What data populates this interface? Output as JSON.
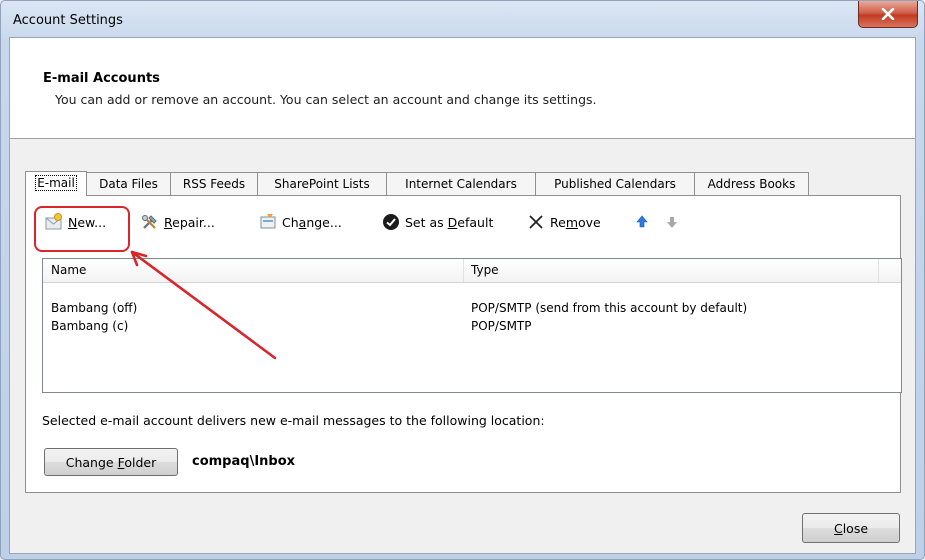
{
  "window": {
    "title": "Account Settings"
  },
  "header": {
    "title": "E-mail Accounts",
    "description": "You can add or remove an account. You can select an account and change its settings."
  },
  "tabs": [
    {
      "label": "E-mail",
      "active": true
    },
    {
      "label": "Data Files"
    },
    {
      "label": "RSS Feeds"
    },
    {
      "label": "SharePoint Lists"
    },
    {
      "label": "Internet Calendars"
    },
    {
      "label": "Published Calendars"
    },
    {
      "label": "Address Books"
    }
  ],
  "toolbar": {
    "new": {
      "pre": "",
      "key": "N",
      "post": "ew...",
      "icon": "new-mail-icon"
    },
    "repair": {
      "pre": "",
      "key": "R",
      "post": "epair...",
      "icon": "repair-tools-icon"
    },
    "change": {
      "pre": "Ch",
      "key": "a",
      "post": "nge...",
      "icon": "change-account-icon"
    },
    "set_default": {
      "pre": "Set as ",
      "key": "D",
      "post": "efault",
      "icon": "checkmark-circle-icon"
    },
    "remove": {
      "pre": "Re",
      "key": "m",
      "post": "ove",
      "icon": "remove-x-icon"
    },
    "move_up": {
      "icon": "arrow-up-icon"
    },
    "move_down": {
      "icon": "arrow-down-icon"
    }
  },
  "list": {
    "columns": [
      "Name",
      "Type"
    ],
    "rows": [
      {
        "name": "Bambang (off)",
        "type": "POP/SMTP (send from this account by default)"
      },
      {
        "name": "Bambang (c)",
        "type": "POP/SMTP"
      }
    ]
  },
  "delivery": {
    "label": "Selected e-mail account delivers new e-mail messages to the following location:",
    "change_folder": {
      "pre": "Change ",
      "key": "F",
      "post": "older"
    },
    "folder_path": "compaq\\Inbox"
  },
  "footer": {
    "close": {
      "pre": "",
      "key": "C",
      "post": "lose"
    }
  },
  "colors": {
    "annotation": "#d9252b",
    "close_button_red": "#c23b22"
  }
}
